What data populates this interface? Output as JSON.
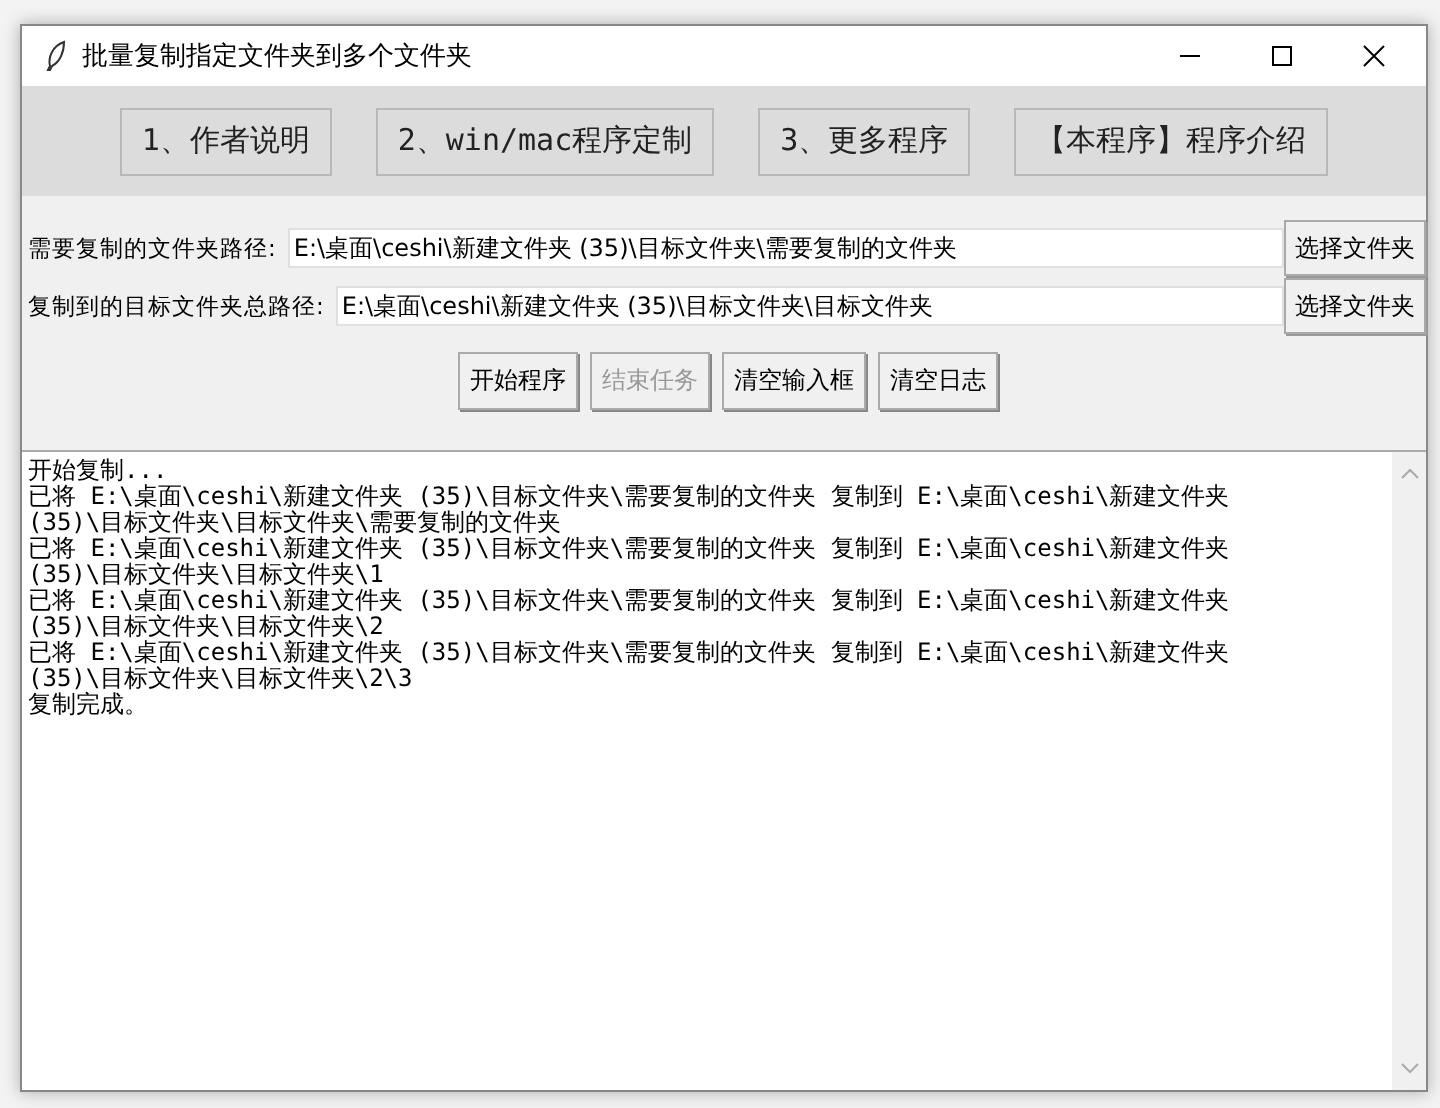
{
  "window": {
    "title": "批量复制指定文件夹到多个文件夹"
  },
  "top_buttons": [
    "1、作者说明",
    "2、win/mac程序定制",
    "3、更多程序",
    "【本程序】程序介绍"
  ],
  "paths": [
    {
      "label": "需要复制的文件夹路径:",
      "value": "E:\\桌面\\ceshi\\新建文件夹 (35)\\目标文件夹\\需要复制的文件夹",
      "button": "选择文件夹"
    },
    {
      "label": "复制到的目标文件夹总路径:",
      "value": "E:\\桌面\\ceshi\\新建文件夹 (35)\\目标文件夹\\目标文件夹",
      "button": "选择文件夹"
    }
  ],
  "actions": [
    {
      "label": "开始程序",
      "disabled": false
    },
    {
      "label": "结束任务",
      "disabled": true
    },
    {
      "label": "清空输入框",
      "disabled": false
    },
    {
      "label": "清空日志",
      "disabled": false
    }
  ],
  "log_lines": [
    "开始复制...",
    "已将 E:\\桌面\\ceshi\\新建文件夹 (35)\\目标文件夹\\需要复制的文件夹 复制到 E:\\桌面\\ceshi\\新建文件夹",
    "(35)\\目标文件夹\\目标文件夹\\需要复制的文件夹",
    "已将 E:\\桌面\\ceshi\\新建文件夹 (35)\\目标文件夹\\需要复制的文件夹 复制到 E:\\桌面\\ceshi\\新建文件夹",
    "(35)\\目标文件夹\\目标文件夹\\1",
    "已将 E:\\桌面\\ceshi\\新建文件夹 (35)\\目标文件夹\\需要复制的文件夹 复制到 E:\\桌面\\ceshi\\新建文件夹",
    "(35)\\目标文件夹\\目标文件夹\\2",
    "已将 E:\\桌面\\ceshi\\新建文件夹 (35)\\目标文件夹\\需要复制的文件夹 复制到 E:\\桌面\\ceshi\\新建文件夹",
    "(35)\\目标文件夹\\目标文件夹\\2\\3",
    "复制完成。"
  ]
}
